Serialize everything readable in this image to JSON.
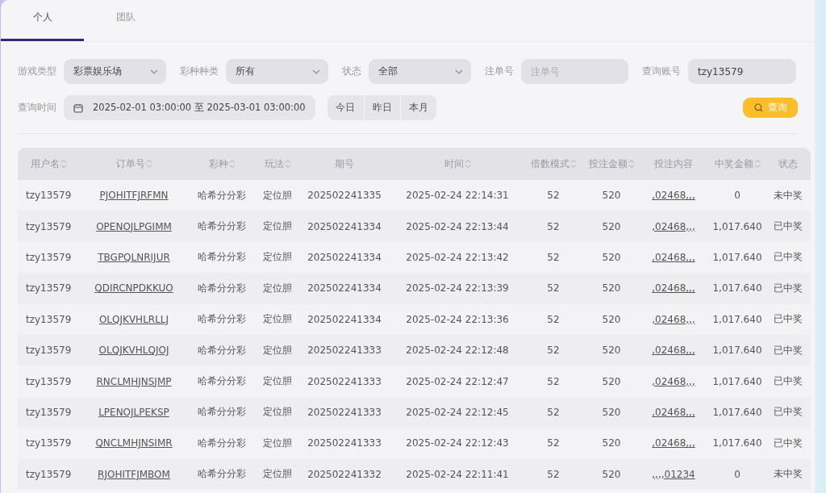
{
  "tabs": [
    {
      "label": "个人",
      "selected": true
    },
    {
      "label": "团队",
      "selected": false
    }
  ],
  "filters": {
    "game_type": {
      "label": "游戏类型",
      "value": "彩票娱乐场"
    },
    "lottery_kind": {
      "label": "彩种种类",
      "value": "所有"
    },
    "status": {
      "label": "状态",
      "value": "全部"
    },
    "order_no": {
      "label": "注单号",
      "placeholder": "注单号"
    },
    "account": {
      "label": "查询账号",
      "value": "tzy13579"
    },
    "time": {
      "label": "查询时间",
      "value": "2025-02-01 03:00:00 至 2025-03-01 03:00:00"
    },
    "quick_ranges": [
      "今日",
      "昨日",
      "本月"
    ],
    "search_button": "查询"
  },
  "table": {
    "columns": [
      {
        "label": "用户名",
        "sortable": true
      },
      {
        "label": "订单号",
        "sortable": true
      },
      {
        "label": "彩种",
        "sortable": true
      },
      {
        "label": "玩法",
        "sortable": true
      },
      {
        "label": "期号",
        "sortable": false
      },
      {
        "label": "时间",
        "sortable": true
      },
      {
        "label": "倍数模式",
        "sortable": true
      },
      {
        "label": "投注金额",
        "sortable": true
      },
      {
        "label": "投注内容",
        "sortable": false
      },
      {
        "label": "中奖金额",
        "sortable": true
      },
      {
        "label": "状态",
        "sortable": false
      }
    ],
    "rows": [
      [
        "tzy13579",
        "PJOHITFJRFMN",
        "哈希分分彩",
        "定位胆",
        "202502241335",
        "2025-02-24 22:14:31",
        "52",
        "520",
        ",02468,,,",
        "0",
        "未中奖"
      ],
      [
        "tzy13579",
        "OPENOJLPGIMM",
        "哈希分分彩",
        "定位胆",
        "202502241334",
        "2025-02-24 22:13:44",
        "52",
        "520",
        ",02468,,,",
        "1,017.640",
        "已中奖"
      ],
      [
        "tzy13579",
        "TBGPQLNRIJUR",
        "哈希分分彩",
        "定位胆",
        "202502241334",
        "2025-02-24 22:13:42",
        "52",
        "520",
        ",02468,,,",
        "1,017.640",
        "已中奖"
      ],
      [
        "tzy13579",
        "QDIRCNPDKKUO",
        "哈希分分彩",
        "定位胆",
        "202502241334",
        "2025-02-24 22:13:39",
        "52",
        "520",
        ",02468,,,",
        "1,017.640",
        "已中奖"
      ],
      [
        "tzy13579",
        "OLQJKVHLRLLJ",
        "哈希分分彩",
        "定位胆",
        "202502241334",
        "2025-02-24 22:13:36",
        "52",
        "520",
        ",02468,,,",
        "1,017.640",
        "已中奖"
      ],
      [
        "tzy13579",
        "OLQJKVHLQJOJ",
        "哈希分分彩",
        "定位胆",
        "202502241333",
        "2025-02-24 22:12:48",
        "52",
        "520",
        ",02468,,,",
        "1,017.640",
        "已中奖"
      ],
      [
        "tzy13579",
        "RNCLMHJNSJMP",
        "哈希分分彩",
        "定位胆",
        "202502241333",
        "2025-02-24 22:12:47",
        "52",
        "520",
        ",02468,,,",
        "1,017.640",
        "已中奖"
      ],
      [
        "tzy13579",
        "LPENOJLPEKSP",
        "哈希分分彩",
        "定位胆",
        "202502241333",
        "2025-02-24 22:12:45",
        "52",
        "520",
        ",02468,,,",
        "1,017.640",
        "已中奖"
      ],
      [
        "tzy13579",
        "QNCLMHJNSIMR",
        "哈希分分彩",
        "定位胆",
        "202502241333",
        "2025-02-24 22:12:43",
        "52",
        "520",
        ",02468,,,",
        "1,017.640",
        "已中奖"
      ],
      [
        "tzy13579",
        "RJOHITFJMBOM",
        "哈希分分彩",
        "定位胆",
        "202502241332",
        "2025-02-24 22:11:41",
        "52",
        "520",
        ",,,,01234",
        "0",
        "未中奖"
      ]
    ]
  }
}
